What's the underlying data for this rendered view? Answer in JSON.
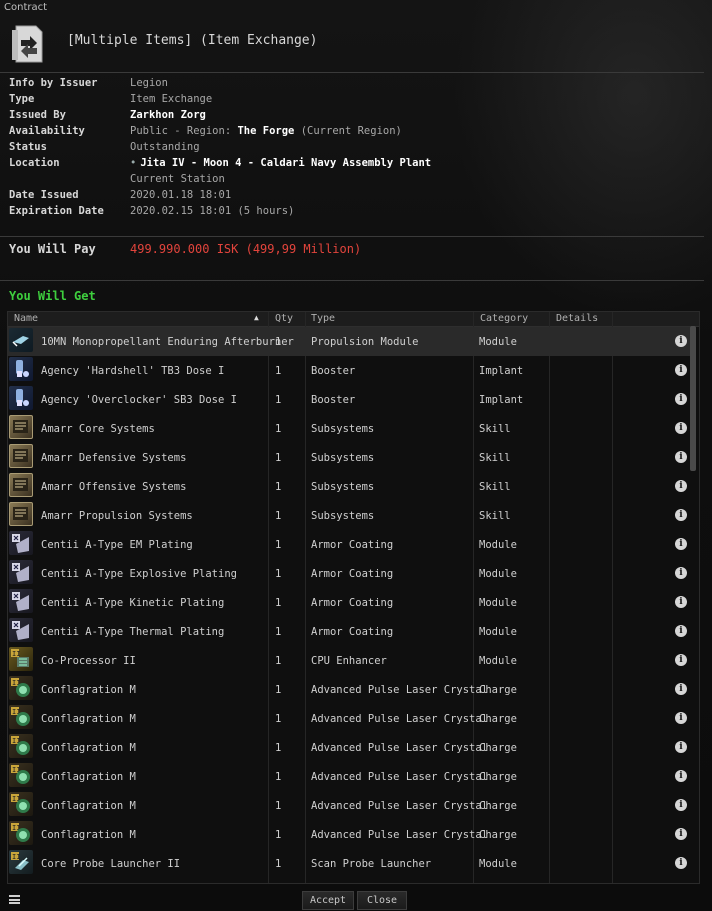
{
  "window": {
    "title": "Contract"
  },
  "header": {
    "title": "[Multiple Items] (Item Exchange)"
  },
  "info": {
    "rows": [
      {
        "label": "Info by Issuer",
        "value": "Legion"
      },
      {
        "label": "Type",
        "value": "Item Exchange"
      },
      {
        "label": "Issued By",
        "value": "Zarkhon Zorg"
      },
      {
        "label": "Availability",
        "value_prefix": "Public - Region:",
        "value_bold": "The Forge",
        "value_suffix": "(Current Region)"
      },
      {
        "label": "Status",
        "value": "Outstanding"
      },
      {
        "label": "Location",
        "value": "Jita IV - Moon 4 - Caldari Navy Assembly Plant",
        "sub": "Current Station"
      },
      {
        "label": "Date Issued",
        "value": "2020.01.18 18:01"
      },
      {
        "label": "Expiration Date",
        "value": "2020.02.15 18:01 (5 hours)"
      }
    ]
  },
  "pay": {
    "label": "You Will Pay",
    "value": "499.990.000 ISK (499,99 Million)",
    "color": "#e2443c"
  },
  "get": {
    "label": "You Will Get",
    "color": "#3ecf3e"
  },
  "columns": {
    "name": "Name",
    "qty": "Qty",
    "type": "Type",
    "category": "Category",
    "details": "Details"
  },
  "items": [
    {
      "name": "10MN Monopropellant Enduring Afterburner",
      "qty": "1",
      "type": "Propulsion Module",
      "category": "Module",
      "icon": "afterburner-icon"
    },
    {
      "name": "Agency 'Hardshell' TB3 Dose I",
      "qty": "1",
      "type": "Booster",
      "category": "Implant",
      "icon": "booster-icon"
    },
    {
      "name": "Agency 'Overclocker' SB3 Dose I",
      "qty": "1",
      "type": "Booster",
      "category": "Implant",
      "icon": "booster-icon"
    },
    {
      "name": "Amarr Core Systems",
      "qty": "1",
      "type": "Subsystems",
      "category": "Skill",
      "icon": "skillbook-icon"
    },
    {
      "name": "Amarr Defensive Systems",
      "qty": "1",
      "type": "Subsystems",
      "category": "Skill",
      "icon": "skillbook-icon"
    },
    {
      "name": "Amarr Offensive Systems",
      "qty": "1",
      "type": "Subsystems",
      "category": "Skill",
      "icon": "skillbook-icon"
    },
    {
      "name": "Amarr Propulsion Systems",
      "qty": "1",
      "type": "Subsystems",
      "category": "Skill",
      "icon": "skillbook-icon"
    },
    {
      "name": "Centii A-Type EM Plating",
      "qty": "1",
      "type": "Armor Coating",
      "category": "Module",
      "icon": "armor-plating-icon"
    },
    {
      "name": "Centii A-Type Explosive Plating",
      "qty": "1",
      "type": "Armor Coating",
      "category": "Module",
      "icon": "armor-plating-icon"
    },
    {
      "name": "Centii A-Type Kinetic Plating",
      "qty": "1",
      "type": "Armor Coating",
      "category": "Module",
      "icon": "armor-plating-icon"
    },
    {
      "name": "Centii A-Type Thermal Plating",
      "qty": "1",
      "type": "Armor Coating",
      "category": "Module",
      "icon": "armor-plating-icon"
    },
    {
      "name": "Co-Processor II",
      "qty": "1",
      "type": "CPU Enhancer",
      "category": "Module",
      "icon": "coprocessor-icon"
    },
    {
      "name": "Conflagration M",
      "qty": "1",
      "type": "Advanced Pulse Laser Crystal",
      "category": "Charge",
      "icon": "laser-crystal-icon"
    },
    {
      "name": "Conflagration M",
      "qty": "1",
      "type": "Advanced Pulse Laser Crystal",
      "category": "Charge",
      "icon": "laser-crystal-icon"
    },
    {
      "name": "Conflagration M",
      "qty": "1",
      "type": "Advanced Pulse Laser Crystal",
      "category": "Charge",
      "icon": "laser-crystal-icon"
    },
    {
      "name": "Conflagration M",
      "qty": "1",
      "type": "Advanced Pulse Laser Crystal",
      "category": "Charge",
      "icon": "laser-crystal-icon"
    },
    {
      "name": "Conflagration M",
      "qty": "1",
      "type": "Advanced Pulse Laser Crystal",
      "category": "Charge",
      "icon": "laser-crystal-icon"
    },
    {
      "name": "Conflagration M",
      "qty": "1",
      "type": "Advanced Pulse Laser Crystal",
      "category": "Charge",
      "icon": "laser-crystal-icon"
    },
    {
      "name": "Core Probe Launcher II",
      "qty": "1",
      "type": "Scan Probe Launcher",
      "category": "Module",
      "icon": "probe-launcher-icon"
    }
  ],
  "buttons": {
    "accept": "Accept",
    "close": "Close"
  }
}
